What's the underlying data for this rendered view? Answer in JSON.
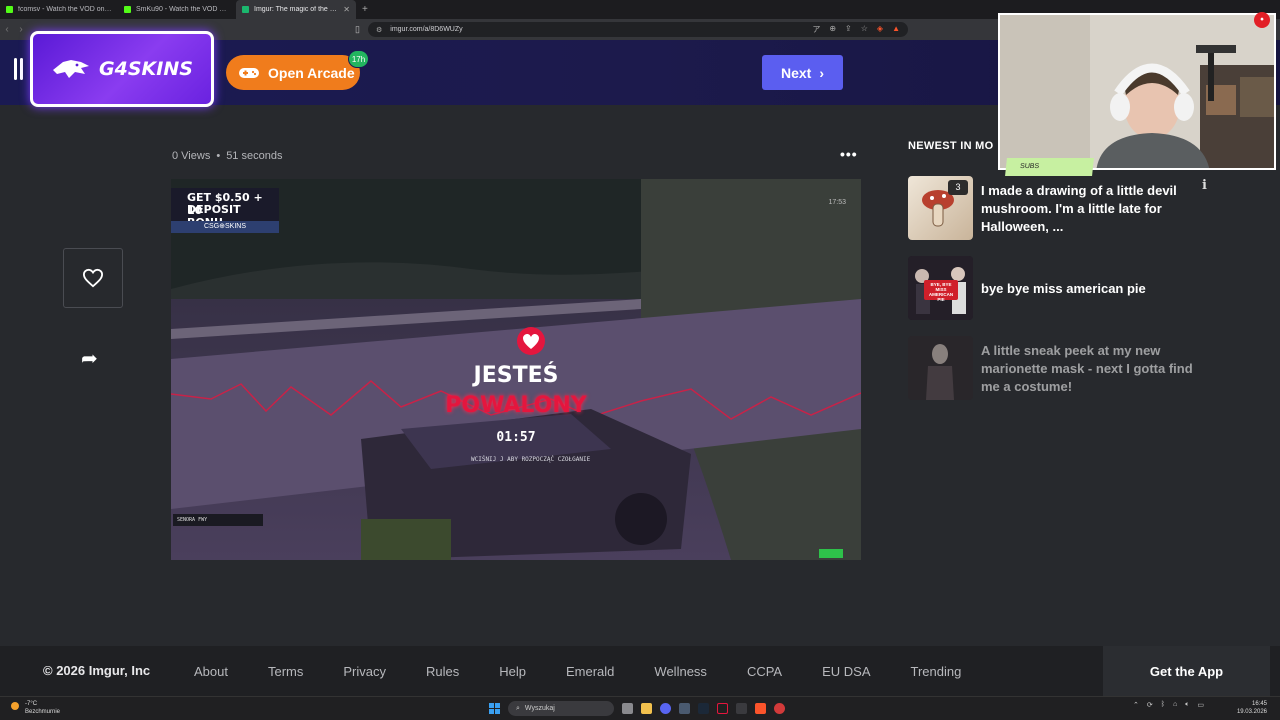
{
  "browser": {
    "tabs": [
      {
        "label": "fcomsv - Watch the VOD on Kick",
        "active": false
      },
      {
        "label": "SmKu90 - Watch the VOD on Kick",
        "active": false
      },
      {
        "label": "Imgur: The magic of the Internet",
        "active": true
      }
    ],
    "url": "imgur.com/a/8D6WUZy"
  },
  "header": {
    "sponsor_brand": "G4SKINS",
    "arcade_label": "Open Arcade",
    "arcade_badge": "17h",
    "next_label": "Next"
  },
  "post": {
    "views": "0 Views",
    "separator": "•",
    "age": "51 seconds",
    "menu_glyph": "•••"
  },
  "video_overlay": {
    "promo_line1": "GET $0.50 + 10",
    "promo_line2": "DEPOSIT BONU",
    "promo_site": "CSG⊕SKINS",
    "line1": "JESTEŚ",
    "line2": "POWALONY",
    "timer": "01:57",
    "hint": "WCIŚNIJ J   ABY ROZPOCZĄĆ CZOŁGANIE",
    "street": "SENORA FWY",
    "corner": "17:53"
  },
  "sidebar": {
    "heading": "NEWEST IN MO",
    "posts": [
      {
        "title": "I made a drawing of a little devil mushroom. I'm a little late for Halloween, ...",
        "count": "3"
      },
      {
        "title": "bye bye miss american pie",
        "count": ""
      },
      {
        "title": "A little sneak peek at my new marionette mask - next I gotta find me a costume!",
        "count": ""
      }
    ],
    "thumb2_caption": "BYE, BYE MISS AMERICAN PIE"
  },
  "webcam": {
    "subs_label": "SUBS"
  },
  "footer": {
    "copyright": "© 2026 Imgur, Inc",
    "links": [
      "About",
      "Terms",
      "Privacy",
      "Rules",
      "Help",
      "Emerald",
      "Wellness",
      "CCPA",
      "EU DSA",
      "Trending"
    ],
    "get_app": "Get the App"
  },
  "taskbar": {
    "temp": "-7°C",
    "weather": "Bezchmurnie",
    "search": "Wyszukaj",
    "time": "16:45",
    "date": "19.03.2026"
  },
  "colors": {
    "header_bg": "#1a1a52",
    "arcade": "#f07c1c",
    "next": "#5b5ef0",
    "page_bg": "#27292d"
  }
}
